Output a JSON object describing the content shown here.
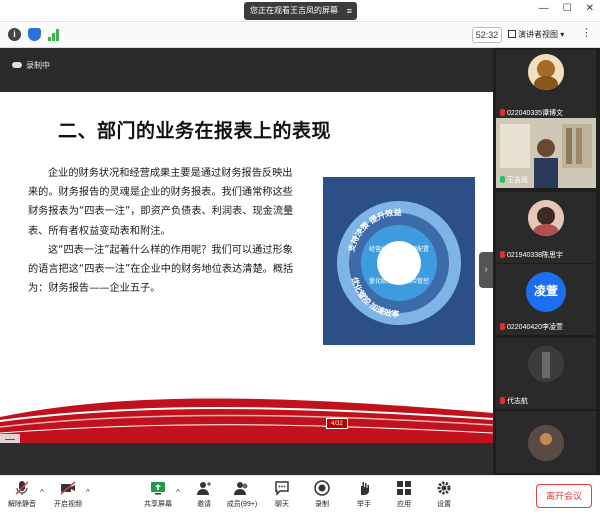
{
  "window": {
    "title": "您正在观看王吉凤的屏幕",
    "menu_icon": "menu-icon"
  },
  "toolbar": {
    "timer": "52:32",
    "view_mode": "演讲者视图",
    "view_caret": "▾",
    "more": "⋮"
  },
  "recording": {
    "label": "录制中"
  },
  "slide": {
    "title": "二、部门的业务在报表上的表现",
    "paragraph_1": "企业的财务状况和经营成果主要是通过财务报告反映出来的。财务报告的灵魂是企业的财务报表。我们通常称这些财务报表为“四表一注”，即资产负债表、利润表、现金流量表、所有者权益变动表和附注。",
    "paragraph_2": "这“四表一注”起着什么样的作用呢？我们可以通过形象的语言把这“四表一注”在企业中的财务地位表达清楚。概括为：财务报告——企业五子。",
    "diagram": {
      "outer_top": "支持决策 提升效益",
      "outer_bottom": "优化管控 加速效率",
      "segments": [
        "经营分析",
        "资源配置",
        "量化绩效",
        "风险管控"
      ]
    },
    "page_badge": "4/32"
  },
  "participants": [
    {
      "name": "022040335谭博文",
      "avatar_text": ""
    },
    {
      "name": "王吉凤",
      "avatar_text": ""
    },
    {
      "name": "021940338陈思宇",
      "avatar_text": ""
    },
    {
      "name": "022040420李凌萱",
      "avatar_text": "凌萱"
    },
    {
      "name": "代志航",
      "avatar_text": ""
    },
    {
      "name": "",
      "avatar_text": ""
    }
  ],
  "bottom_bar": {
    "mute": "解除静音",
    "video": "开启视频",
    "share": "共享屏幕",
    "invite": "邀请",
    "members": "成员(99+)",
    "chat": "聊天",
    "record": "录制",
    "raise_hand": "举手",
    "apps": "应用",
    "settings": "设置",
    "leave": "离开会议",
    "caret": "^"
  },
  "colors": {
    "accent_blue": "#1d6ff2",
    "leave_red": "#e23c3c",
    "speaking_green": "#26c26a",
    "slide_wave_red": "#c0121c"
  }
}
